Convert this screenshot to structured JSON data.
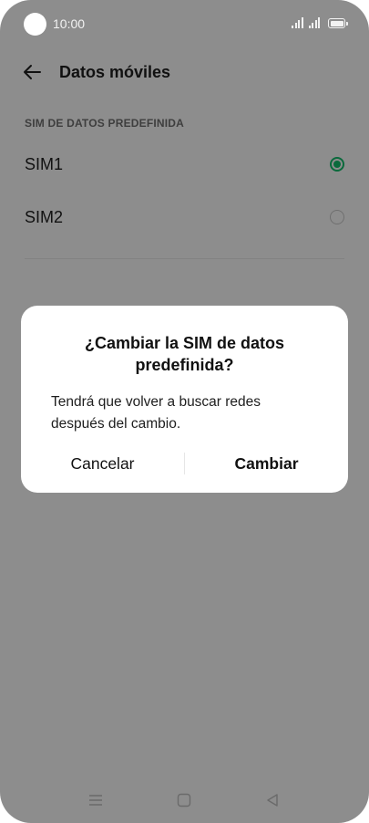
{
  "status_bar": {
    "time": "10:00"
  },
  "header": {
    "title": "Datos móviles"
  },
  "section": {
    "title": "SIM DE DATOS PREDEFINIDA"
  },
  "sim_options": [
    {
      "label": "SIM1",
      "selected": true
    },
    {
      "label": "SIM2",
      "selected": false
    }
  ],
  "dialog": {
    "title_line1": "¿Cambiar la SIM de datos",
    "title_line2": "predefinida?",
    "message_line1": "Tendrá que volver a buscar redes",
    "message_line2": "después del cambio.",
    "cancel_label": "Cancelar",
    "confirm_label": "Cambiar"
  },
  "colors": {
    "scrim": "#8d8d8d",
    "accent": "#0a6a3c",
    "dialog_bg": "#ffffff"
  },
  "icons": {
    "back": "arrow-left-icon",
    "nav_menu": "menu-lines-icon",
    "nav_home": "square-home-icon",
    "nav_back": "triangle-back-icon"
  }
}
